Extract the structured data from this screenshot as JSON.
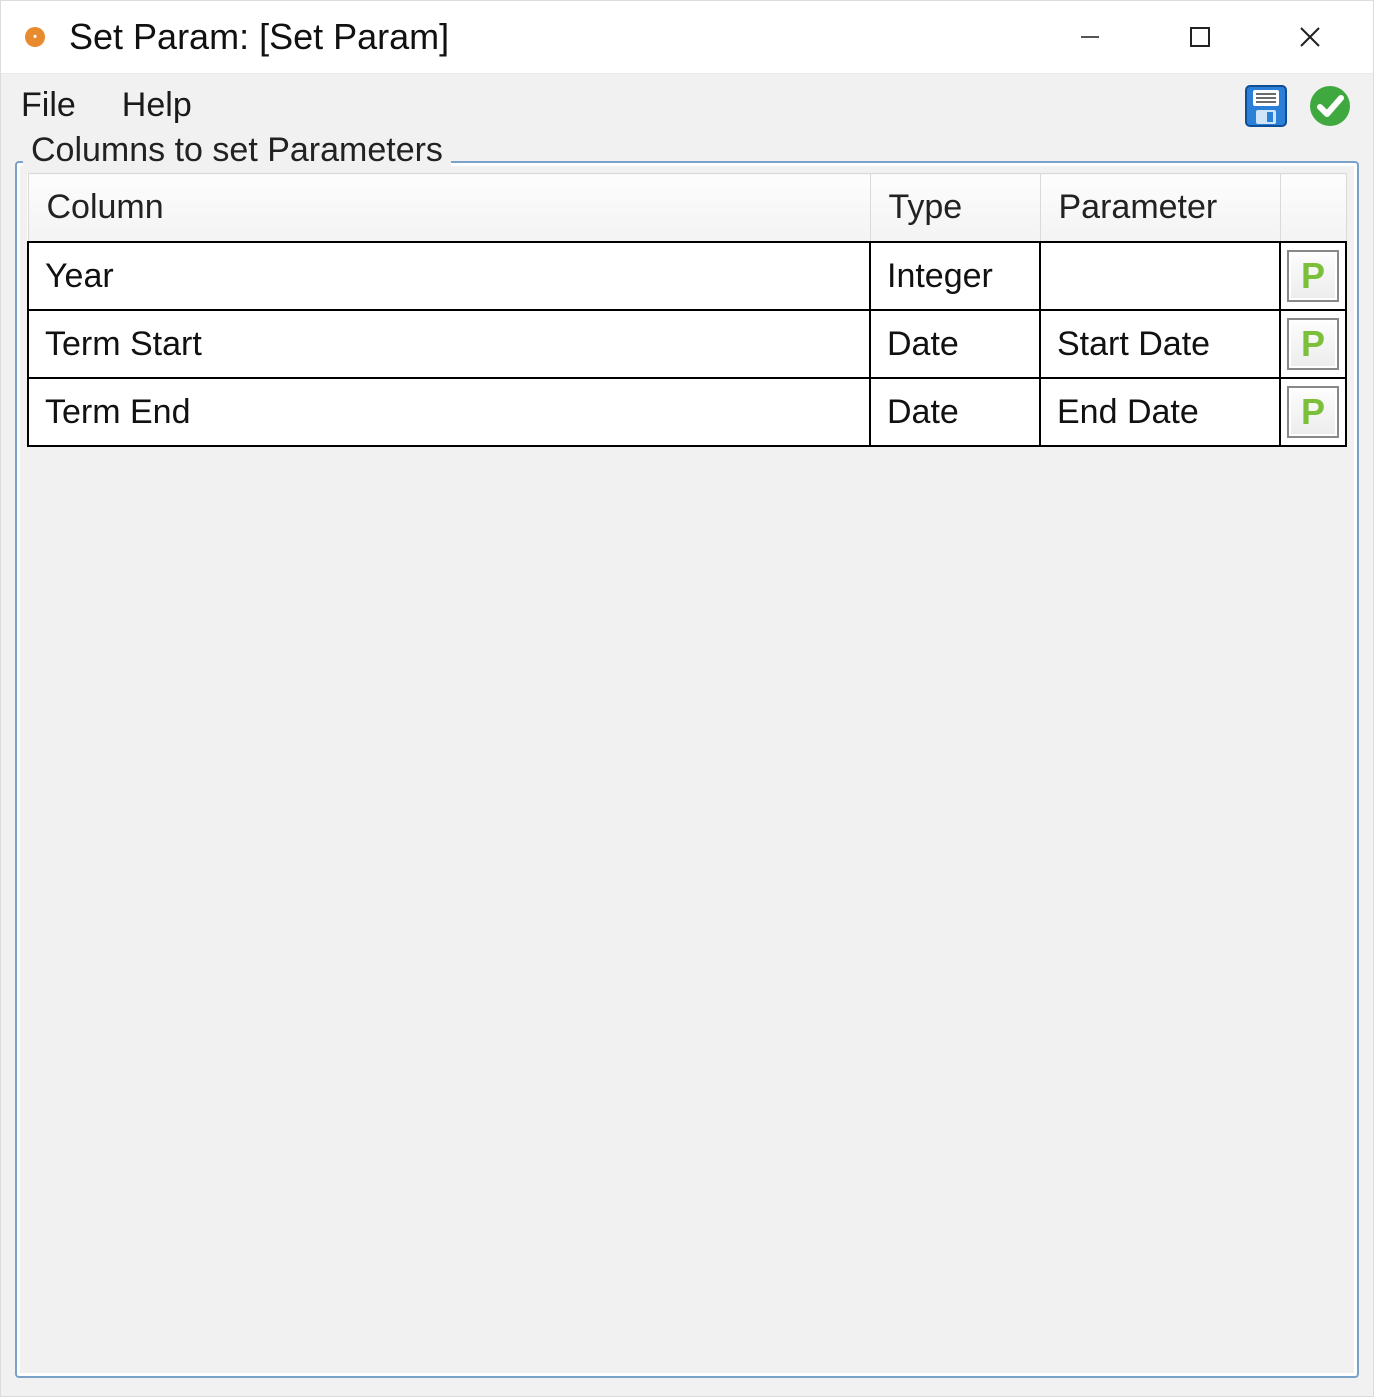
{
  "window": {
    "title": "Set Param: [Set Param]"
  },
  "menu": {
    "file": "File",
    "help": "Help"
  },
  "icons": {
    "save": "save-icon",
    "ok": "check-icon"
  },
  "group": {
    "legend": "Columns to set Parameters"
  },
  "table": {
    "headers": {
      "column": "Column",
      "type": "Type",
      "parameter": "Parameter"
    },
    "rows": [
      {
        "column": "Year",
        "type": "Integer",
        "parameter": "",
        "p_label": "P"
      },
      {
        "column": "Term Start",
        "type": "Date",
        "parameter": "Start Date",
        "p_label": "P"
      },
      {
        "column": "Term End",
        "type": "Date",
        "parameter": "End Date",
        "p_label": "P"
      }
    ]
  }
}
